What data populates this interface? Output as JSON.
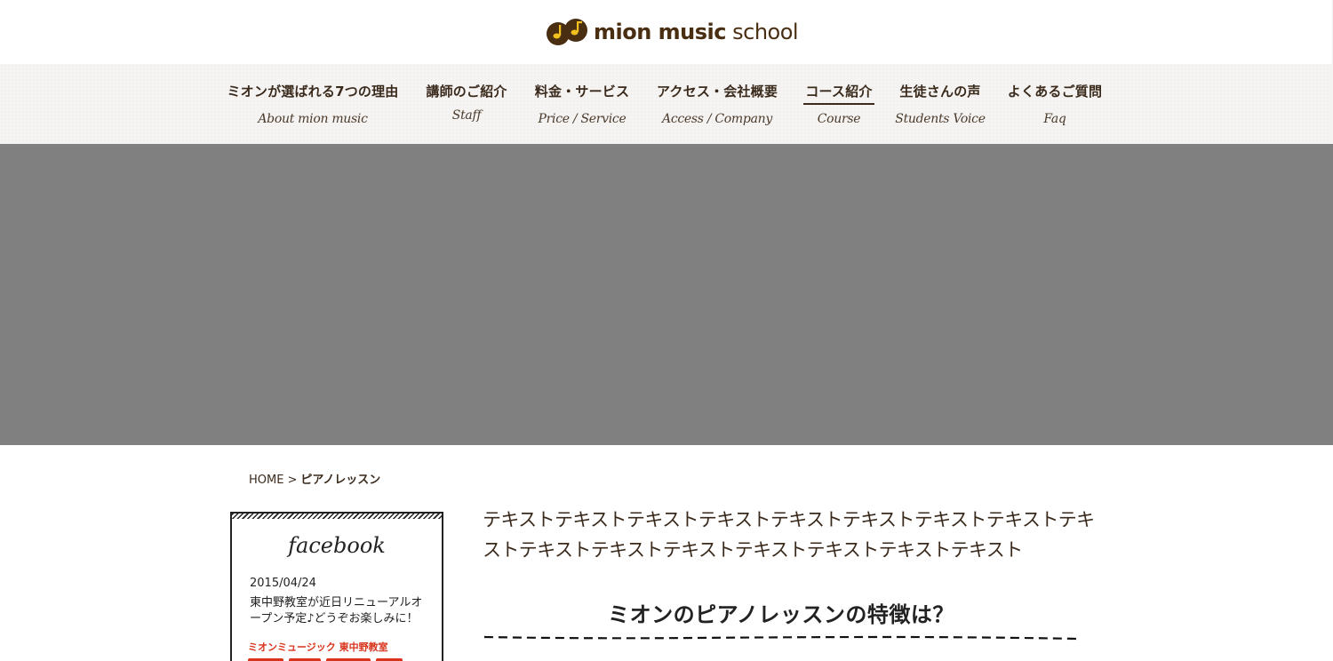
{
  "header": {
    "logo_text_bold": "mion music",
    "logo_text_light": "school"
  },
  "nav": {
    "items": [
      {
        "jp": "ミオンが選ばれる7つの理由",
        "en": "About mion music"
      },
      {
        "jp": "講師のご紹介",
        "en": "Staff"
      },
      {
        "jp": "料金・サービス",
        "en": "Price / Service"
      },
      {
        "jp": "アクセス・会社概要",
        "en": "Access / Company"
      },
      {
        "jp": "コース紹介",
        "en": "Course"
      },
      {
        "jp": "生徒さんの声",
        "en": "Students Voice"
      },
      {
        "jp": "よくあるご質問",
        "en": "Faq"
      }
    ],
    "active_index": 4
  },
  "breadcrumb": {
    "home": "HOME",
    "separator": ">",
    "current": "ピアノレッスン"
  },
  "sidebar": {
    "facebook": {
      "title": "facebook",
      "date": "2015/04/24",
      "text": "東中野教室が近日リニューアルオープン予定♪どうぞお楽しみに！",
      "banner_text": "ミオンミュージック 東中野教室"
    }
  },
  "main": {
    "intro": "テキストテキストテキストテキストテキストテキストテキストテキストテキストテキストテキストテキストテキストテキストテキストテキスト",
    "heading": "ミオンのピアノレッスンの特徴は？"
  },
  "colors": {
    "brand_brown": "#4a2e12",
    "logo_yellow": "#f2c01e",
    "hero_gray": "#808080",
    "nav_bg": "#f6f4f2",
    "banner_red": "#d8341c"
  }
}
